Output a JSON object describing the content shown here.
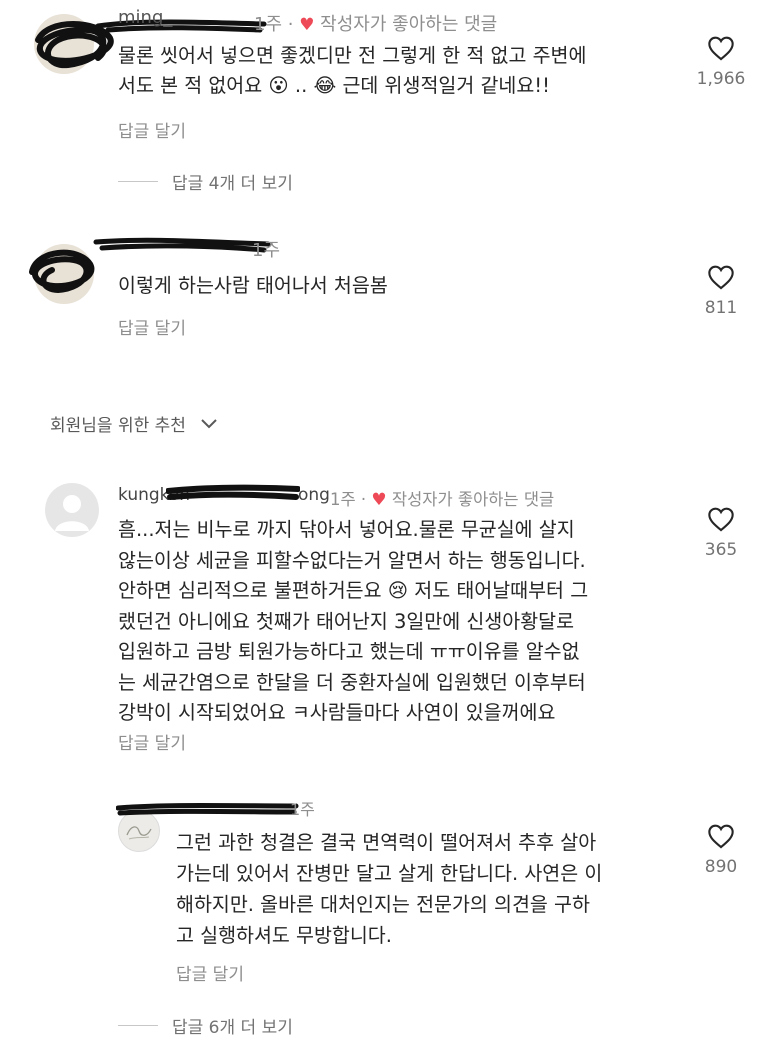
{
  "comments": [
    {
      "meta": "1주 · ",
      "author_liked": "작성자가 좋아하는 댓글",
      "lines": [
        "물론 씻어서 넣으면 좋겠디만 전 그렇게 한 적 없고 주변에",
        "서도 본 적 없어요 😮 .. 😂  근데 위생적일거 같네요!!"
      ],
      "reply_label": "답글 달기",
      "likes": "1,966",
      "more_replies": "답글 4개 더 보기"
    },
    {
      "meta": "1주",
      "lines": [
        "이렇게 하는사람 태어나서 처음봄"
      ],
      "reply_label": "답글 달기",
      "likes": "811"
    },
    {
      "meta": "1주 · ",
      "author_liked": "작성자가 좋아하는 댓글",
      "lines": [
        "흠...저는 비누로 까지 닦아서 넣어요.물론 무균실에 살지",
        "않는이상 세균을 피할수없다는거 알면서 하는 행동입니다.",
        "안하면 심리적으로 불편하거든요 😢 저도 태어날때부터 그",
        "랬던건 아니에요 첫째가 태어난지 3일만에 신생아황달로",
        "입원하고 금방 퇴원가능하다고 했는데 ㅠㅠ이유를 알수없",
        "는 세균간염으로 한달을 더 중환자실에 입원했던 이후부터",
        "강박이 시작되었어요 ㅋ사람들마다 사연이 있을꺼에요"
      ],
      "reply_label": "답글 달기",
      "likes": "365"
    },
    {
      "meta": "1주",
      "lines": [
        "그런 과한 청결은 결국 면역력이 떨어져서 추후 살아",
        "가는데 있어서 잔병만 달고 살게 한답니다. 사연은 이",
        "해하지만. 올바른 대처인지는 전문가의 의견을 구하",
        "고 실행하셔도 무방합니다."
      ],
      "reply_label": "답글 달기",
      "likes": "890",
      "more_replies": "답글 6개 더 보기"
    }
  ],
  "usernames": {
    "c1": "ming_",
    "c3_start": "kungkon",
    "c3_end": "ong"
  },
  "section_title": "회원님을 위한 추천",
  "icons": {
    "like": "heart-outline-icon",
    "expand": "chevron-down-icon",
    "author_like": "heart-filled-icon"
  },
  "colors": {
    "heart": "#ed4956",
    "secondary": "#8e8e8e",
    "primary": "#262626"
  }
}
